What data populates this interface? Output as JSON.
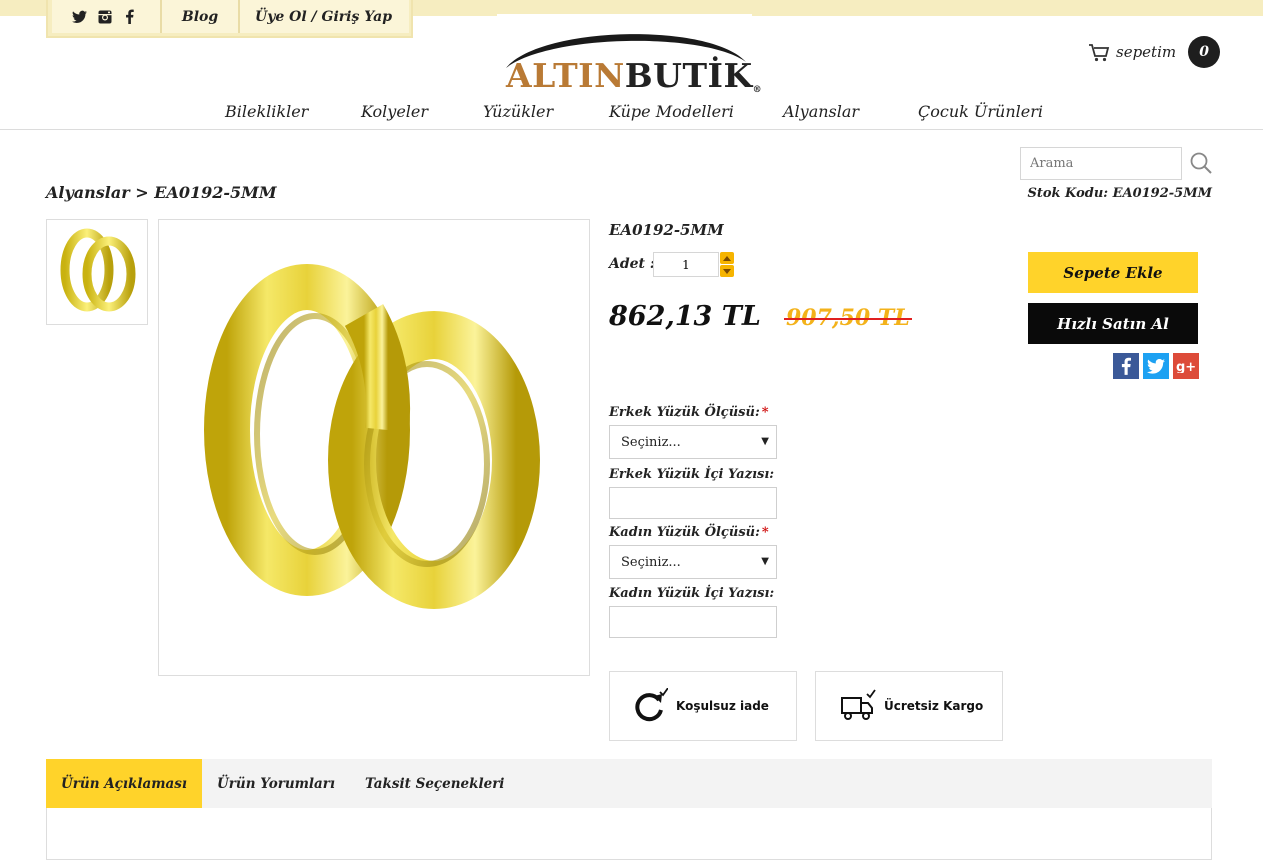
{
  "topbar": {
    "social": [
      {
        "icon": "twitter-icon",
        "label": "Twitter"
      },
      {
        "icon": "instagram-icon",
        "label": "Instagram"
      },
      {
        "icon": "facebook-icon",
        "label": "Facebook"
      }
    ],
    "blog": "Blog",
    "account": "Üye Ol / Giriş Yap"
  },
  "logo": {
    "part1": "ALTIN",
    "part2": "BUTİK",
    "mark": "®"
  },
  "cart": {
    "label": "sepetim",
    "count": "0"
  },
  "nav": [
    "Bileklikler",
    "Kolyeler",
    "Yüzükler",
    "Küpe Modelleri",
    "Alyanslar",
    "Çocuk Ürünleri"
  ],
  "search": {
    "placeholder": "Arama"
  },
  "breadcrumb": "Alyanslar > EA0192-5MM",
  "stock": "Stok Kodu: EA0192-5MM",
  "product": {
    "name": "EA0192-5MM",
    "qty_label": "Adet :",
    "qty_value": "1",
    "price": "862,13 TL",
    "old_price": "907,50 TL",
    "add_to_cart": "Sepete Ekle",
    "buy_now": "Hızlı Satın Al"
  },
  "share": [
    {
      "icon": "facebook-share-icon",
      "color": "#3b5998"
    },
    {
      "icon": "twitter-share-icon",
      "color": "#1da1f2"
    },
    {
      "icon": "google-plus-share-icon",
      "color": "#dd4b39"
    }
  ],
  "options": {
    "men_size_label": "Erkek Yüzük Ölçüsü:",
    "men_size_value": "Seçiniz...",
    "men_engraving_label": "Erkek Yüzük İçi Yazısı:",
    "women_size_label": "Kadın Yüzük Ölçüsü:",
    "women_size_value": "Seçiniz...",
    "women_engraving_label": "Kadın Yüzük İçi Yazısı:",
    "required_mark": "*"
  },
  "features": [
    {
      "icon": "return-icon",
      "label": "Koşulsuz iade"
    },
    {
      "icon": "shipping-truck-icon",
      "label": "Ücretsiz Kargo"
    }
  ],
  "tabs": [
    "Ürün Açıklaması",
    "Ürün Yorumları",
    "Taksit Seçenekleri"
  ],
  "colors": {
    "accent": "#ffd32a",
    "dark": "#0a0a0a",
    "old_price": "#f3b21a",
    "strike": "#e02020",
    "logo_gold": "#b97a35"
  }
}
